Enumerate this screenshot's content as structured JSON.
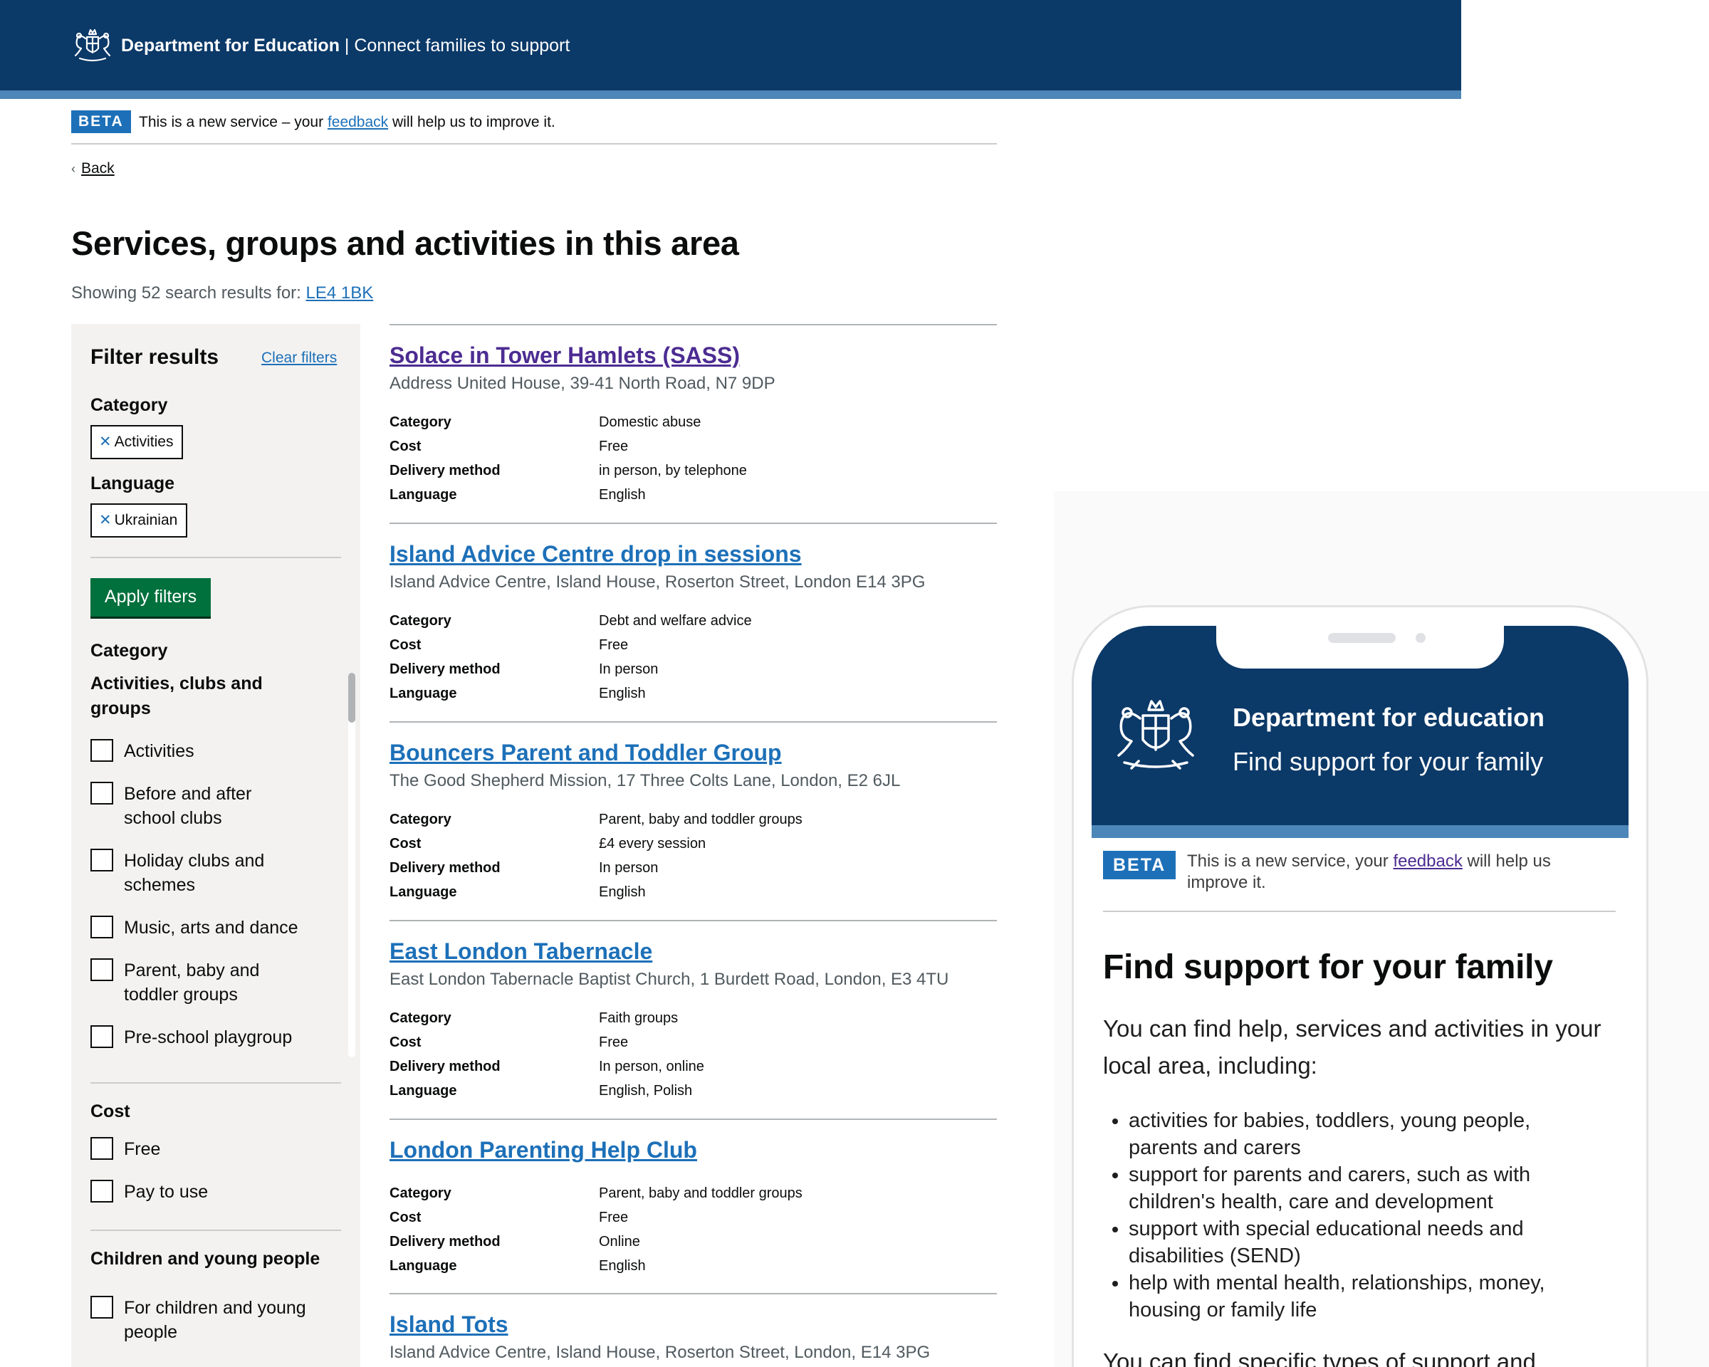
{
  "header": {
    "org": "Department for Education",
    "separator": " | ",
    "service": "Connect families to support"
  },
  "beta": {
    "tag": "BETA",
    "text_before": "This is a new service – your ",
    "link": "feedback",
    "text_after": " will help us to improve it."
  },
  "back_link": "Back",
  "page_title": "Services, groups and activities in this area",
  "results_summary": {
    "prefix": "Showing 52 search results for: ",
    "postcode": "LE4 1BK"
  },
  "filters": {
    "title": "Filter results",
    "clear": "Clear filters",
    "selected_category_label": "Category",
    "selected_category_tag": "Activities",
    "selected_language_label": "Language",
    "selected_language_tag": "Ukrainian",
    "apply_button": "Apply filters",
    "category_label": "Category",
    "category_group": "Activities, clubs and groups",
    "category_options": [
      "Activities",
      "Before and after school clubs",
      "Holiday clubs and schemes",
      "Music, arts and dance",
      "Parent, baby and toddler groups",
      "Pre-school playgroup"
    ],
    "cost_label": "Cost",
    "cost_options": [
      "Free",
      "Pay to use"
    ],
    "children_label": "Children and young people",
    "children_options": [
      "For children and young people"
    ]
  },
  "field_labels": {
    "category": "Category",
    "cost": "Cost",
    "delivery": "Delivery method",
    "language": "Language"
  },
  "results": [
    {
      "title": "Solace in Tower Hamlets (SASS)",
      "address": "Address United House, 39-41 North Road, N7 9DP",
      "category": "Domestic abuse",
      "cost": "Free",
      "delivery": "in person, by telephone",
      "language": "English"
    },
    {
      "title": "Island Advice Centre drop in sessions",
      "address": "Island Advice Centre, Island House, Roserton Street, London E14 3PG",
      "category": "Debt and welfare advice",
      "cost": "Free",
      "delivery": "In person",
      "language": "English"
    },
    {
      "title": "Bouncers Parent and Toddler Group",
      "address": "The Good Shepherd Mission, 17 Three Colts Lane, London, E2 6JL",
      "category": "Parent, baby and toddler groups",
      "cost": "£4 every session",
      "delivery": "In person",
      "language": "English"
    },
    {
      "title": "East London Tabernacle",
      "address": "East London Tabernacle Baptist Church, 1 Burdett Road, London, E3 4TU",
      "category": "Faith groups",
      "cost": "Free",
      "delivery": "In person, online",
      "language": "English, Polish"
    },
    {
      "title": "London Parenting Help Club",
      "address": "",
      "category": "Parent, baby and toddler groups",
      "cost": "Free",
      "delivery": "Online",
      "language": "English"
    },
    {
      "title": "Island Tots",
      "address": "Island Advice Centre, Island House, Roserton Street, London, E14 3PG"
    }
  ],
  "phone": {
    "org": "Department for education",
    "service": "Find support for your family",
    "beta_tag": "BETA",
    "beta_before": "This is a new service, your ",
    "beta_link": "feedback",
    "beta_after": " will help us improve it.",
    "title": "Find support for your family",
    "intro": "You can find help, services and activities in your local area, including:",
    "list": [
      "activities for babies, toddlers, young people, parents and carers",
      "support for parents and carers, such as with children's health, care and development",
      "support with special educational needs and disabilities (SEND)",
      "help with mental health, relationships, money, housing or family life"
    ],
    "more": "You can find specific types of support and"
  },
  "icons": {
    "crest": "royal-coat-of-arms-icon",
    "back": "chevron-left-icon",
    "remove": "cross-icon"
  },
  "colors": {
    "header_bg": "#0b3968",
    "stripe": "#4d86b8",
    "link": "#1d70b8",
    "visited": "#4c2c92",
    "button": "#00703c",
    "panel_bg": "#f3f2f1"
  }
}
